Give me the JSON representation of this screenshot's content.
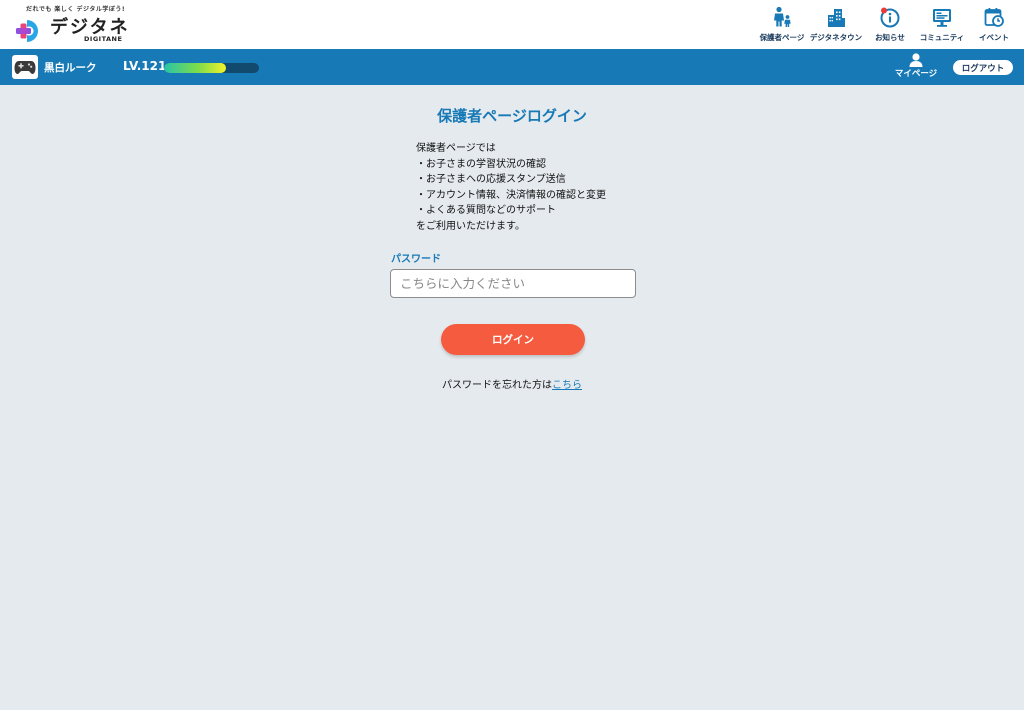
{
  "header": {
    "logo": {
      "tagline": "だれでも 楽しく デジタル学ぼう!",
      "wordmark": "デジタネ",
      "subtitle": "DIGITANE"
    },
    "nav": [
      {
        "label": "保護者ページ",
        "icon": "parent-child-icon"
      },
      {
        "label": "デジタネタウン",
        "icon": "town-buildings-icon"
      },
      {
        "label": "お知らせ",
        "icon": "info-icon"
      },
      {
        "label": "コミュニティ",
        "icon": "monitor-community-icon"
      },
      {
        "label": "イベント",
        "icon": "calendar-clock-icon"
      }
    ]
  },
  "userbar": {
    "username": "黒白ルーク",
    "level": "LV.121",
    "level_progress": 0.65,
    "mypage_label": "マイページ",
    "logout_label": "ログアウト"
  },
  "main": {
    "title": "保護者ページログイン",
    "description": [
      "保護者ページでは",
      "・お子さまの学習状況の確認",
      "・お子さまへの応援スタンプ送信",
      "・アカウント情報、決済情報の確認と変更",
      "・よくある質問などのサポート",
      "をご利用いただけます。"
    ],
    "password_label": "パスワード",
    "password_placeholder": "こちらに入力ください",
    "password_value": "",
    "login_button": "ログイン",
    "forgot_text": "パスワードを忘れた方は",
    "forgot_link": "こちら"
  },
  "colors": {
    "brand_blue": "#1779b6",
    "login_orange": "#f55b3f",
    "background": "#e5eaee"
  }
}
